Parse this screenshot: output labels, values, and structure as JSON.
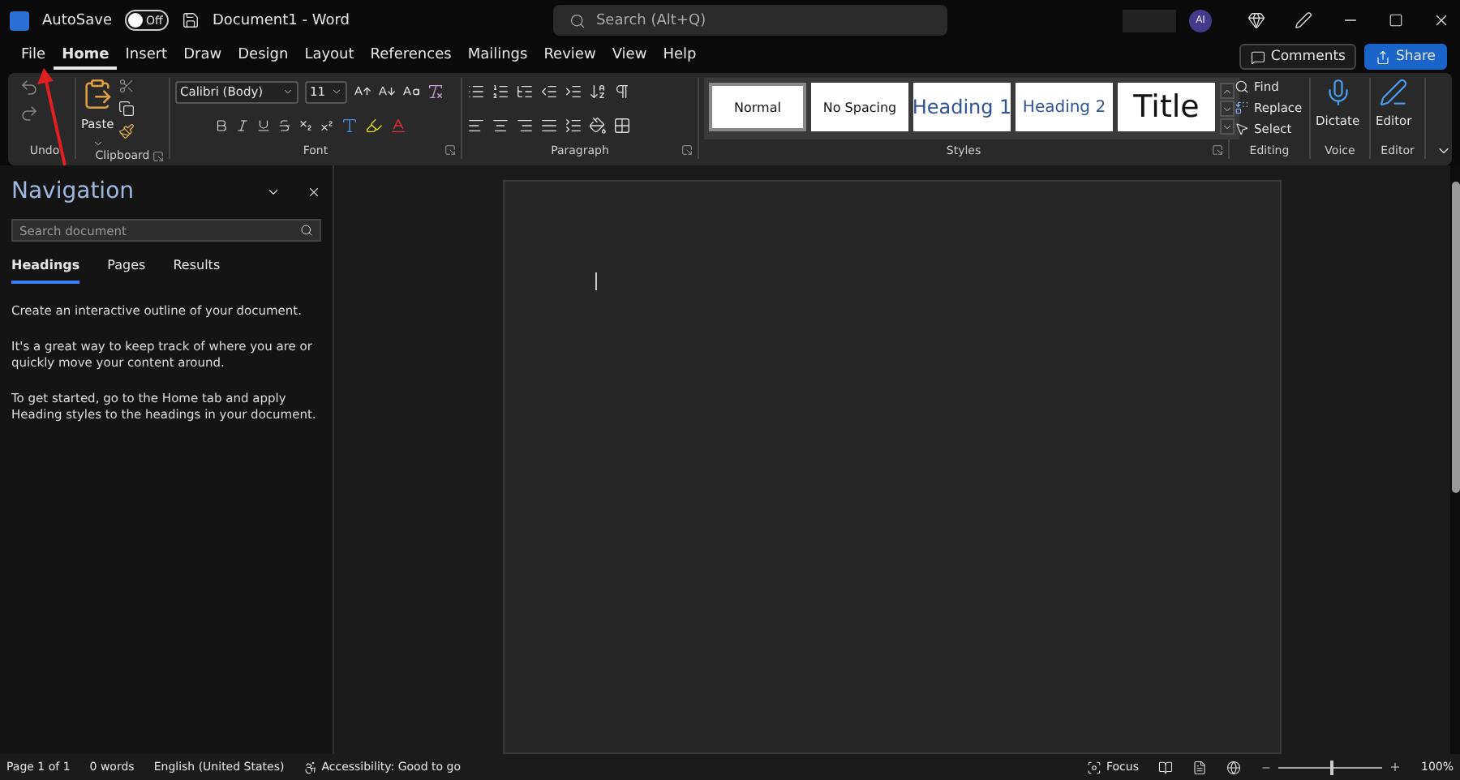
{
  "title_bar": {
    "autosave_label": "AutoSave",
    "autosave_on": false,
    "autosave_state": "Off",
    "document_title": "Document1  -  Word",
    "search_placeholder": "Search (Alt+Q)",
    "avatar_initials": "AI"
  },
  "ribbon_tabs": [
    {
      "label": "File",
      "selected": false
    },
    {
      "label": "Home",
      "selected": true
    },
    {
      "label": "Insert",
      "selected": false
    },
    {
      "label": "Draw",
      "selected": false
    },
    {
      "label": "Design",
      "selected": false
    },
    {
      "label": "Layout",
      "selected": false
    },
    {
      "label": "References",
      "selected": false
    },
    {
      "label": "Mailings",
      "selected": false
    },
    {
      "label": "Review",
      "selected": false
    },
    {
      "label": "View",
      "selected": false
    },
    {
      "label": "Help",
      "selected": false
    }
  ],
  "comments_button": "Comments",
  "share_button": "Share",
  "ribbon": {
    "group_labels": [
      "Undo",
      "Clipboard",
      "Font",
      "Paragraph",
      "Styles",
      "Editing",
      "Voice",
      "Editor"
    ],
    "paste_label": "Paste",
    "font_name": "Calibri (Body)",
    "font_size": "11",
    "styles": [
      {
        "label": "Normal",
        "kind": "normal",
        "selected": true
      },
      {
        "label": "No Spacing",
        "kind": "plain",
        "selected": false
      },
      {
        "label": "Heading 1",
        "kind": "heading1",
        "selected": false
      },
      {
        "label": "Heading 2",
        "kind": "heading2",
        "selected": false
      },
      {
        "label": "Title",
        "kind": "title",
        "selected": false
      }
    ],
    "editing": [
      {
        "label": "Find",
        "kind": "find"
      },
      {
        "label": "Replace",
        "kind": "replace"
      },
      {
        "label": "Select",
        "kind": "select"
      }
    ],
    "dictate_label": "Dictate",
    "editor_label": "Editor"
  },
  "navigation": {
    "title": "Navigation",
    "search_placeholder": "Search document",
    "tabs": [
      {
        "label": "Headings",
        "selected": true
      },
      {
        "label": "Pages",
        "selected": false
      },
      {
        "label": "Results",
        "selected": false
      }
    ],
    "paragraphs": [
      "Create an interactive outline of your document.",
      "It's a great way to keep track of where you are or quickly move your content around.",
      "To get started, go to the Home tab and apply Heading styles to the headings in your document."
    ]
  },
  "status_bar": {
    "items": [
      "Page 1 of 1",
      "0 words",
      "English (United States)"
    ],
    "accessibility": "Accessibility: Good to go",
    "focus": "Focus",
    "zoom_slider": {
      "level": 0.5
    },
    "zoom": "100%"
  }
}
